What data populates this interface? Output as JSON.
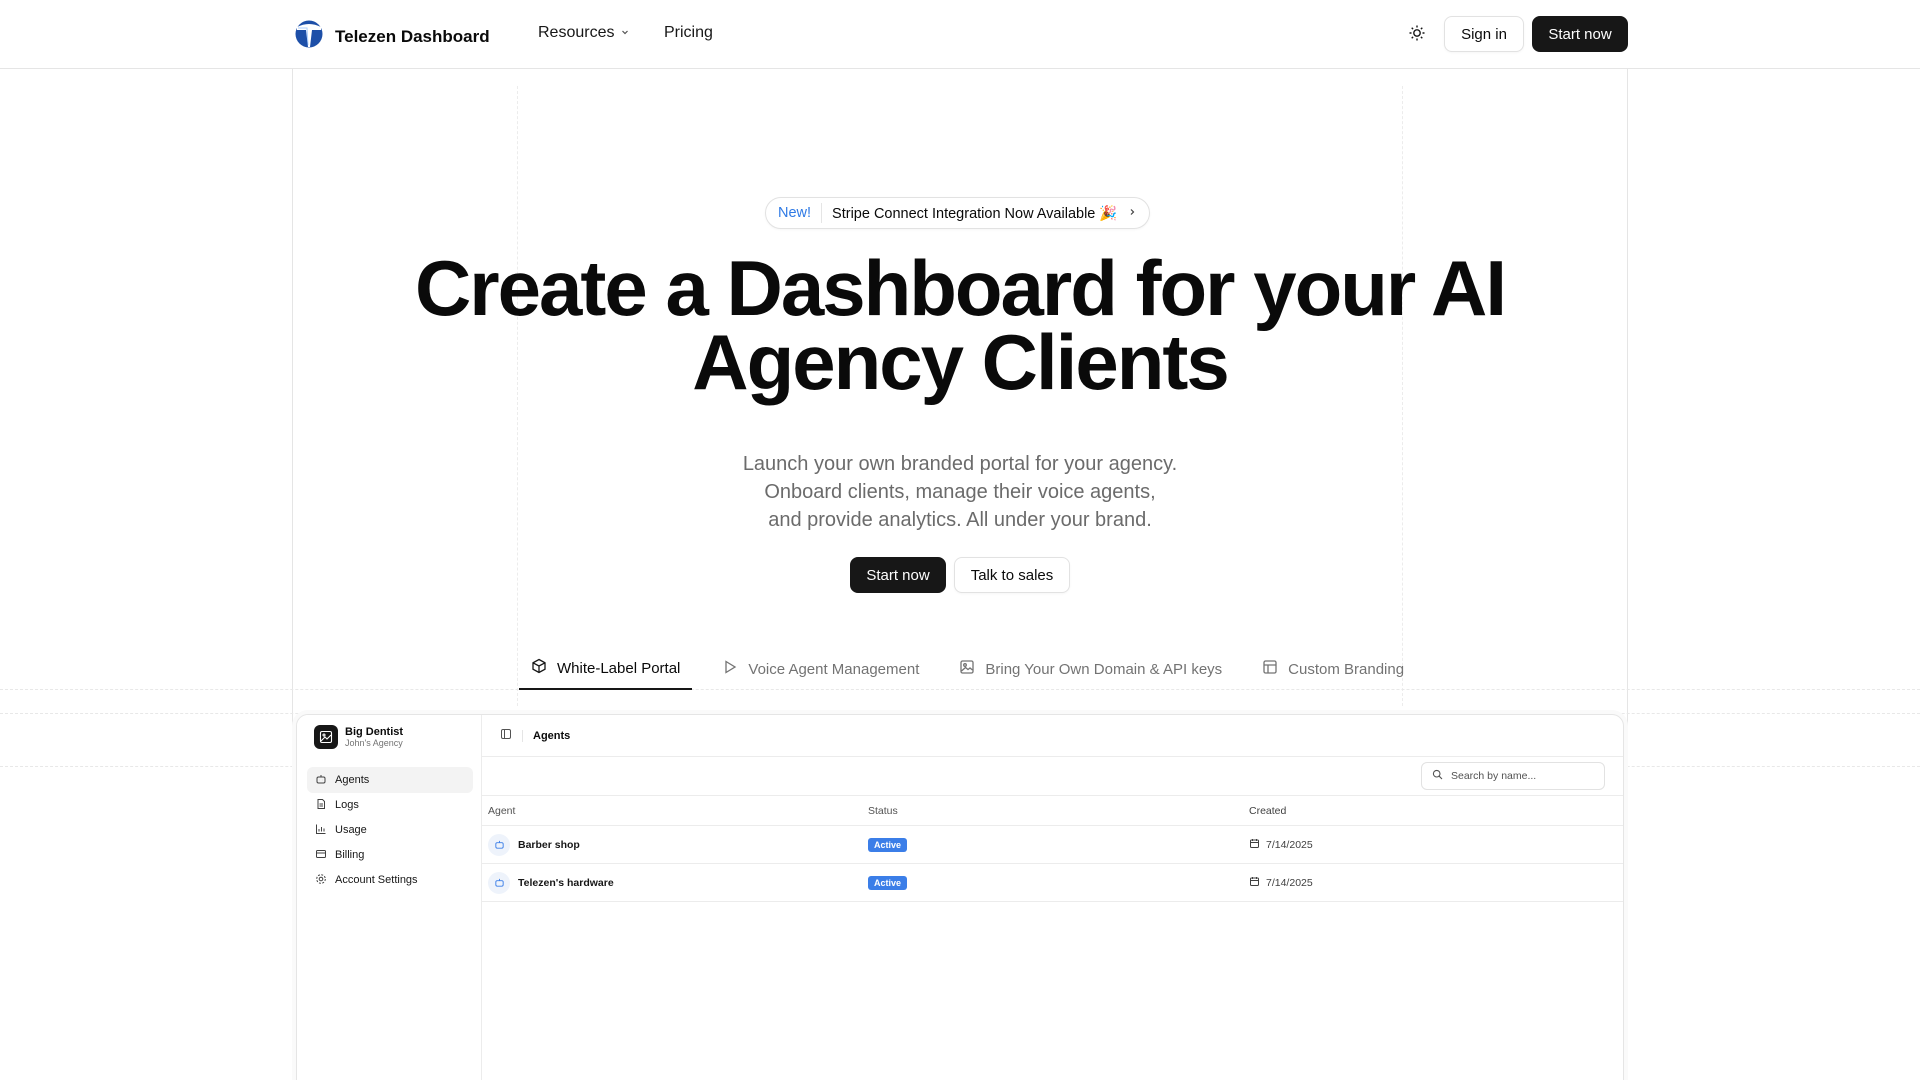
{
  "nav": {
    "brand": "Telezen Dashboard",
    "links": [
      {
        "label": "Resources"
      },
      {
        "label": "Pricing"
      }
    ],
    "signin": "Sign in",
    "start": "Start now"
  },
  "announcement": {
    "tag": "New!",
    "text": "Stripe Connect Integration Now Available 🎉"
  },
  "hero": {
    "title_line1": "Create a Dashboard for your AI",
    "title_line2": "Agency Clients",
    "sub_line1": "Launch your own branded portal for your agency.",
    "sub_line2": "Onboard clients, manage their voice agents,",
    "sub_line3": "and provide analytics. All under your brand.",
    "primary": "Start now",
    "secondary": "Talk to sales"
  },
  "tabs": [
    {
      "label": "White-Label Portal",
      "icon": "cube-icon",
      "active": true
    },
    {
      "label": "Voice Agent Management",
      "icon": "play-icon"
    },
    {
      "label": "Bring Your Own Domain & API keys",
      "icon": "image-icon"
    },
    {
      "label": "Custom Branding",
      "icon": "layout-icon"
    }
  ],
  "app": {
    "org_name": "Big Dentist",
    "org_sub": "John's Agency",
    "sidebar": [
      {
        "label": "Agents",
        "icon": "bot-icon",
        "active": true
      },
      {
        "label": "Logs",
        "icon": "file-icon"
      },
      {
        "label": "Usage",
        "icon": "bar-chart-icon"
      },
      {
        "label": "Billing",
        "icon": "credit-card-icon"
      },
      {
        "label": "Account Settings",
        "icon": "gear-icon"
      }
    ],
    "page_title": "Agents",
    "search_placeholder": "Search by name...",
    "columns": [
      "Agent",
      "Status",
      "Created"
    ],
    "rows": [
      {
        "agent": "Barber shop",
        "status": "Active",
        "created": "7/14/2025"
      },
      {
        "agent": "Telezen's hardware",
        "status": "Active",
        "created": "7/14/2025"
      }
    ]
  },
  "colors": {
    "accent": "#3b7ee8",
    "dark": "#171717",
    "new_tag": "#2f7ae5"
  }
}
